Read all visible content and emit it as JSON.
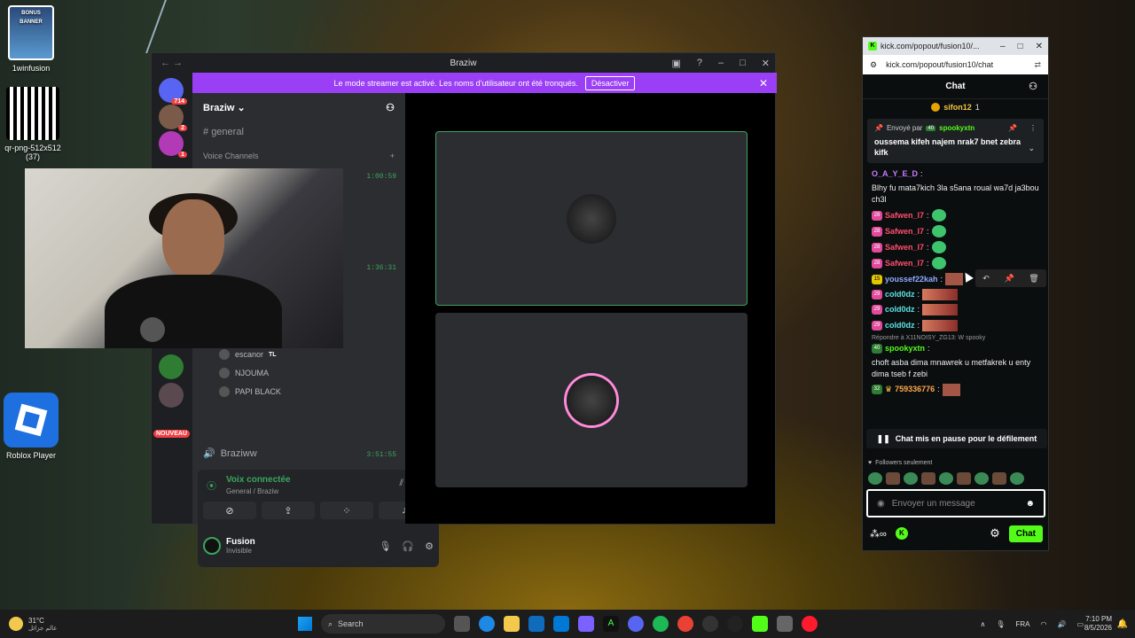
{
  "desktop": {
    "icons": [
      {
        "label": "1winfusion",
        "art_text": "BONUS BANNER"
      },
      {
        "label": "qr-png-512x512 (37)"
      },
      {
        "label": "Roblox Player"
      }
    ]
  },
  "discord": {
    "window_title": "Braziw",
    "banner": {
      "text": "Le mode streamer est activé. Les noms d'utilisateur ont été tronqués.",
      "button": "Désactiver"
    },
    "server_badges": [
      "714",
      "2",
      "1"
    ],
    "new_badge": "NOUVEAU",
    "server_name": "Braziw",
    "text_channel": "general",
    "voice_channels_label": "Voice Channels",
    "timers": [
      "1:00:59",
      "1:36:31",
      "3:51:55"
    ],
    "voice_users": [
      {
        "name": "escanor",
        "tag": "TL"
      },
      {
        "name": "NJOUMA"
      },
      {
        "name": "PAPI BLACK"
      }
    ],
    "voice_self": "Braziww",
    "voice_status": "Voix connectée",
    "voice_location": "General / Braziw",
    "user_name": "Fusion",
    "user_status": "Invisible"
  },
  "kick": {
    "tab_title": "kick.com/popout/fusion10/...",
    "url": "kick.com/popout/fusion10/chat",
    "header": "Chat",
    "top_gifter": {
      "name": "sifon12",
      "count": "1"
    },
    "pinned": {
      "by_label": "Envoyé par",
      "by_badge": "40",
      "by_user": "spookyxtn",
      "message": "oussema kifeh najem nrak7 bnet zebra kifk"
    },
    "messages": [
      {
        "user": "O_A_Y_E_D",
        "text": "Blhy fu mata7kich 3la s5ana roual wa7d ja3bou ch3l",
        "color": "#c77dff"
      },
      {
        "badge": "28",
        "user": "Safwen_l7",
        "text": "",
        "color": "#ff4d6d",
        "emote": true
      },
      {
        "badge": "28",
        "user": "Safwen_l7",
        "text": "",
        "color": "#ff4d6d",
        "emote": true
      },
      {
        "badge": "28",
        "user": "Safwen_l7",
        "text": "",
        "color": "#ff4d6d",
        "emote": true
      },
      {
        "badge": "28",
        "user": "Safwen_l7",
        "text": "",
        "color": "#ff4d6d",
        "emote": true
      },
      {
        "badge": "15",
        "user": "youssef22kah",
        "text": "",
        "color": "#8eaaff"
      },
      {
        "badge": "29",
        "user": "cold0dz",
        "text": "",
        "color": "#5ee3e3",
        "emote2": true
      },
      {
        "badge": "29",
        "user": "cold0dz",
        "text": "",
        "color": "#5ee3e3",
        "emote2": true
      },
      {
        "badge": "29",
        "user": "cold0dz",
        "text": "",
        "color": "#5ee3e3",
        "emote2": true
      }
    ],
    "reply_to": "Répondre à X11NOISY_ZG13: W spooky",
    "reply_msg": {
      "badge": "40",
      "user": "spookyxtn",
      "text": "choft asba dima mnawrek u metfakrek u enty dima tseb f zebi",
      "color": "#53fc18"
    },
    "last_msg": {
      "badge": "32",
      "user": "759336776",
      "color": "#ffa94d"
    },
    "hidden_msg": "759336776:",
    "paused": "Chat mis en pause pour le défilement",
    "followers": "Followers seulement",
    "input_placeholder": "Envoyer un message",
    "chat_button": "Chat"
  },
  "taskbar": {
    "temp": "31°C",
    "weather_text": "عالم جزائل",
    "search": "Search",
    "lang": "FRA",
    "time": "7:10 PM",
    "date": "8/5/2026"
  }
}
